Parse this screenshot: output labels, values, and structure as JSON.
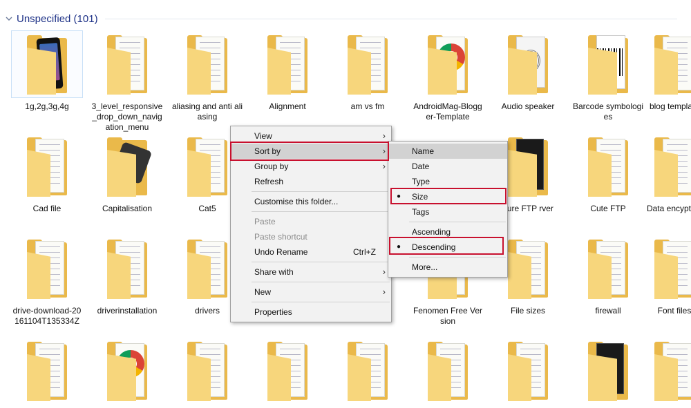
{
  "group": {
    "title": "Unspecified (101)"
  },
  "files": [
    {
      "name": "1g,2g,3g,4g",
      "selected": true,
      "thumb": "phone"
    },
    {
      "name": "3_level_responsive_drop_down_navigation_menu",
      "thumb": "doc"
    },
    {
      "name": "aliasing and anti aliasing",
      "thumb": "doc"
    },
    {
      "name": "Alignment",
      "thumb": "doc"
    },
    {
      "name": "am vs fm",
      "thumb": "doc"
    },
    {
      "name": "AndroidMag-Blogger-Template",
      "thumb": "chrome"
    },
    {
      "name": "Audio speaker",
      "thumb": "speaker"
    },
    {
      "name": "Barcode symbologies",
      "thumb": "barcode"
    },
    {
      "name": "blog template",
      "thumb": "doc"
    },
    {
      "name": "Cad file",
      "thumb": "doc"
    },
    {
      "name": "Capitalisation",
      "thumb": "device"
    },
    {
      "name": "Cat5",
      "thumb": "doc"
    },
    {
      "name": "",
      "thumb": "hidden"
    },
    {
      "name": "",
      "thumb": "hidden"
    },
    {
      "name": "",
      "thumb": "hidden"
    },
    {
      "name": "gure FTP rver",
      "thumb": "dark"
    },
    {
      "name": "Cute FTP",
      "thumb": "doc"
    },
    {
      "name": "Data encyption",
      "thumb": "doc"
    },
    {
      "name": "drive-download-20161104T135334Z",
      "thumb": "doc"
    },
    {
      "name": "driverinstallation",
      "thumb": "doc"
    },
    {
      "name": "drivers",
      "thumb": "doc"
    },
    {
      "name": "",
      "thumb": "hidden"
    },
    {
      "name": "",
      "thumb": "hidden"
    },
    {
      "name": "Fenomen Free Version",
      "thumb": "chrome"
    },
    {
      "name": "File sizes",
      "thumb": "doc"
    },
    {
      "name": "firewall",
      "thumb": "doc"
    },
    {
      "name": "Font files",
      "thumb": "doc"
    },
    {
      "name": "",
      "thumb": "doc"
    },
    {
      "name": "",
      "thumb": "chrome"
    },
    {
      "name": "",
      "thumb": "doc"
    },
    {
      "name": "",
      "thumb": "doc"
    },
    {
      "name": "",
      "thumb": "doc"
    },
    {
      "name": "",
      "thumb": "doc"
    },
    {
      "name": "",
      "thumb": "doc"
    },
    {
      "name": "",
      "thumb": "dark"
    },
    {
      "name": "",
      "thumb": "doc"
    }
  ],
  "context_menu": {
    "items": [
      {
        "label": "View",
        "submenu": true
      },
      {
        "label": "Sort by",
        "submenu": true,
        "active": true
      },
      {
        "label": "Group by",
        "submenu": true
      },
      {
        "label": "Refresh"
      },
      {
        "sep": true
      },
      {
        "label": "Customise this folder..."
      },
      {
        "sep": true
      },
      {
        "label": "Paste",
        "disabled": true
      },
      {
        "label": "Paste shortcut",
        "disabled": true
      },
      {
        "label": "Undo Rename",
        "shortcut": "Ctrl+Z"
      },
      {
        "sep": true
      },
      {
        "label": "Share with",
        "submenu": true
      },
      {
        "sep": true
      },
      {
        "label": "New",
        "submenu": true
      },
      {
        "sep": true
      },
      {
        "label": "Properties"
      }
    ]
  },
  "sort_menu": {
    "items": [
      {
        "label": "Name",
        "active": true
      },
      {
        "label": "Date"
      },
      {
        "label": "Type"
      },
      {
        "label": "Size",
        "checked": true
      },
      {
        "label": "Tags"
      },
      {
        "sep": true
      },
      {
        "label": "Ascending"
      },
      {
        "label": "Descending",
        "checked": true
      },
      {
        "sep": true
      },
      {
        "label": "More..."
      }
    ]
  },
  "colors": {
    "highlight_box": "#c8102e",
    "folder": "#eab94a",
    "group_title": "#1e3287"
  }
}
